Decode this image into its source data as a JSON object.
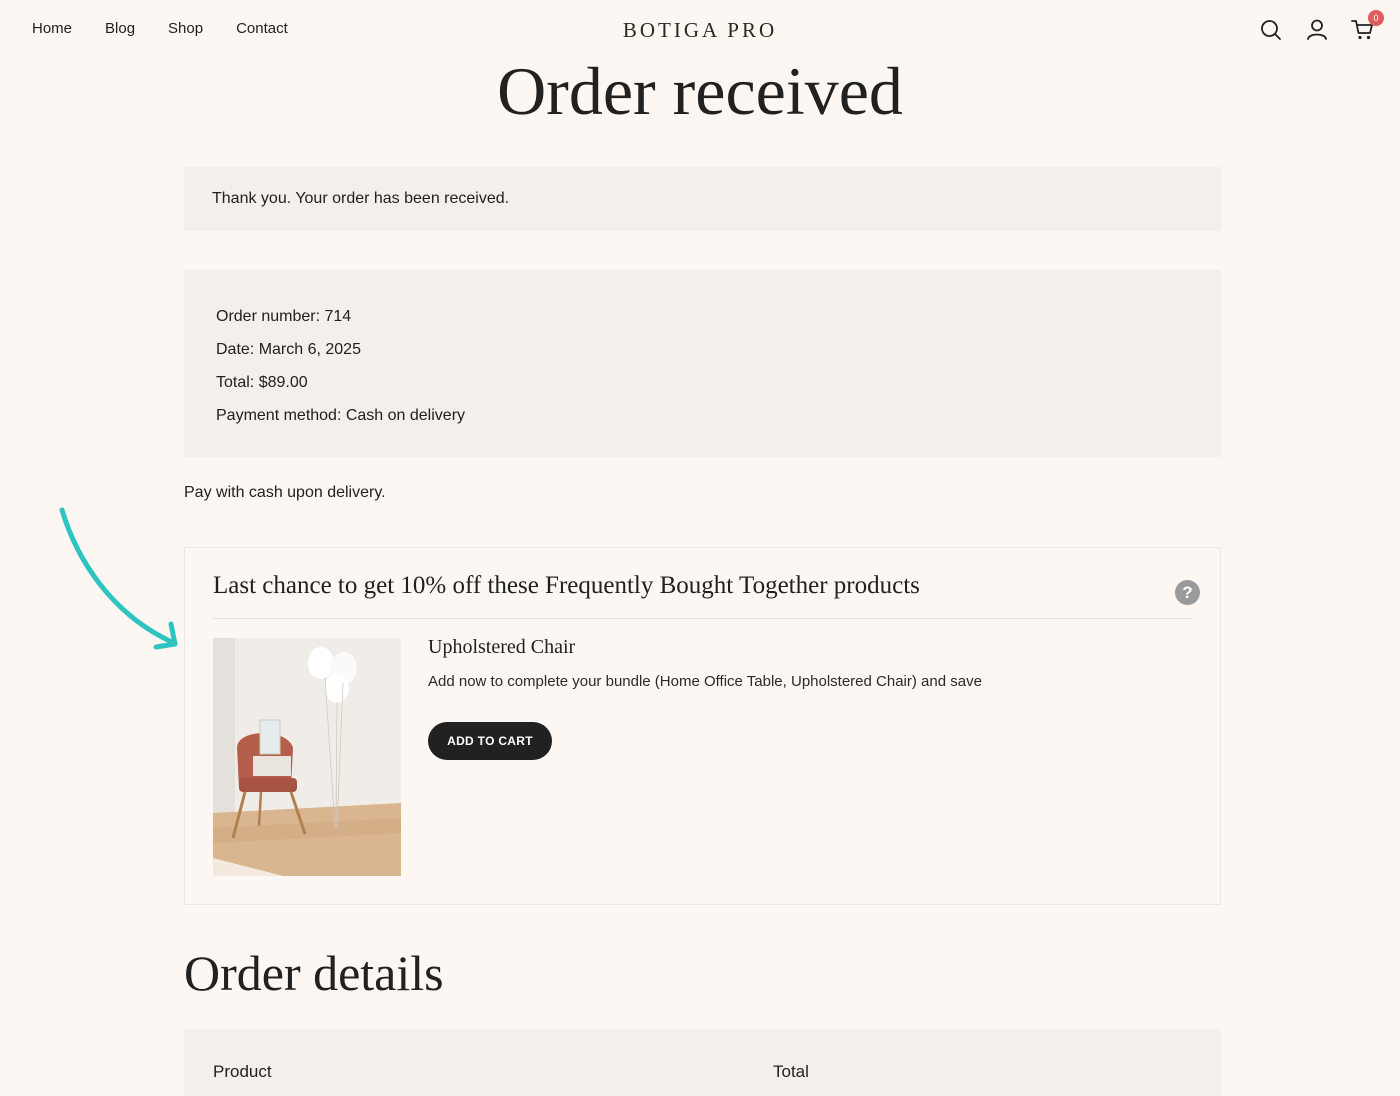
{
  "header": {
    "nav": [
      "Home",
      "Blog",
      "Shop",
      "Contact"
    ],
    "logo": "BOTIGA PRO",
    "cart_count": "0",
    "icons": [
      "search-icon",
      "user-icon",
      "cart-icon"
    ]
  },
  "page_title": "Order received",
  "notice": "Thank you. Your order has been received.",
  "overview": {
    "order_number": "Order number: 714",
    "date": "Date: March 6, 2025",
    "total": "Total: $89.00",
    "payment_method": "Payment method: Cash on delivery"
  },
  "payment_note": "Pay with cash upon delivery.",
  "fbt": {
    "title": "Last chance to get 10% off these Frequently Bought Together products",
    "help": "?",
    "product_name": "Upholstered Chair",
    "product_desc": "Add now to complete your bundle (Home Office Table, Upholstered Chair) and save",
    "button_label": "ADD TO CART"
  },
  "order_details": {
    "title": "Order details",
    "columns": [
      "Product",
      "Total"
    ]
  },
  "colors": {
    "background": "#fcf7f3",
    "panel": "#f3efea",
    "button": "#212121",
    "arrow": "#2ec4c0",
    "badge": "#e05b5b"
  }
}
